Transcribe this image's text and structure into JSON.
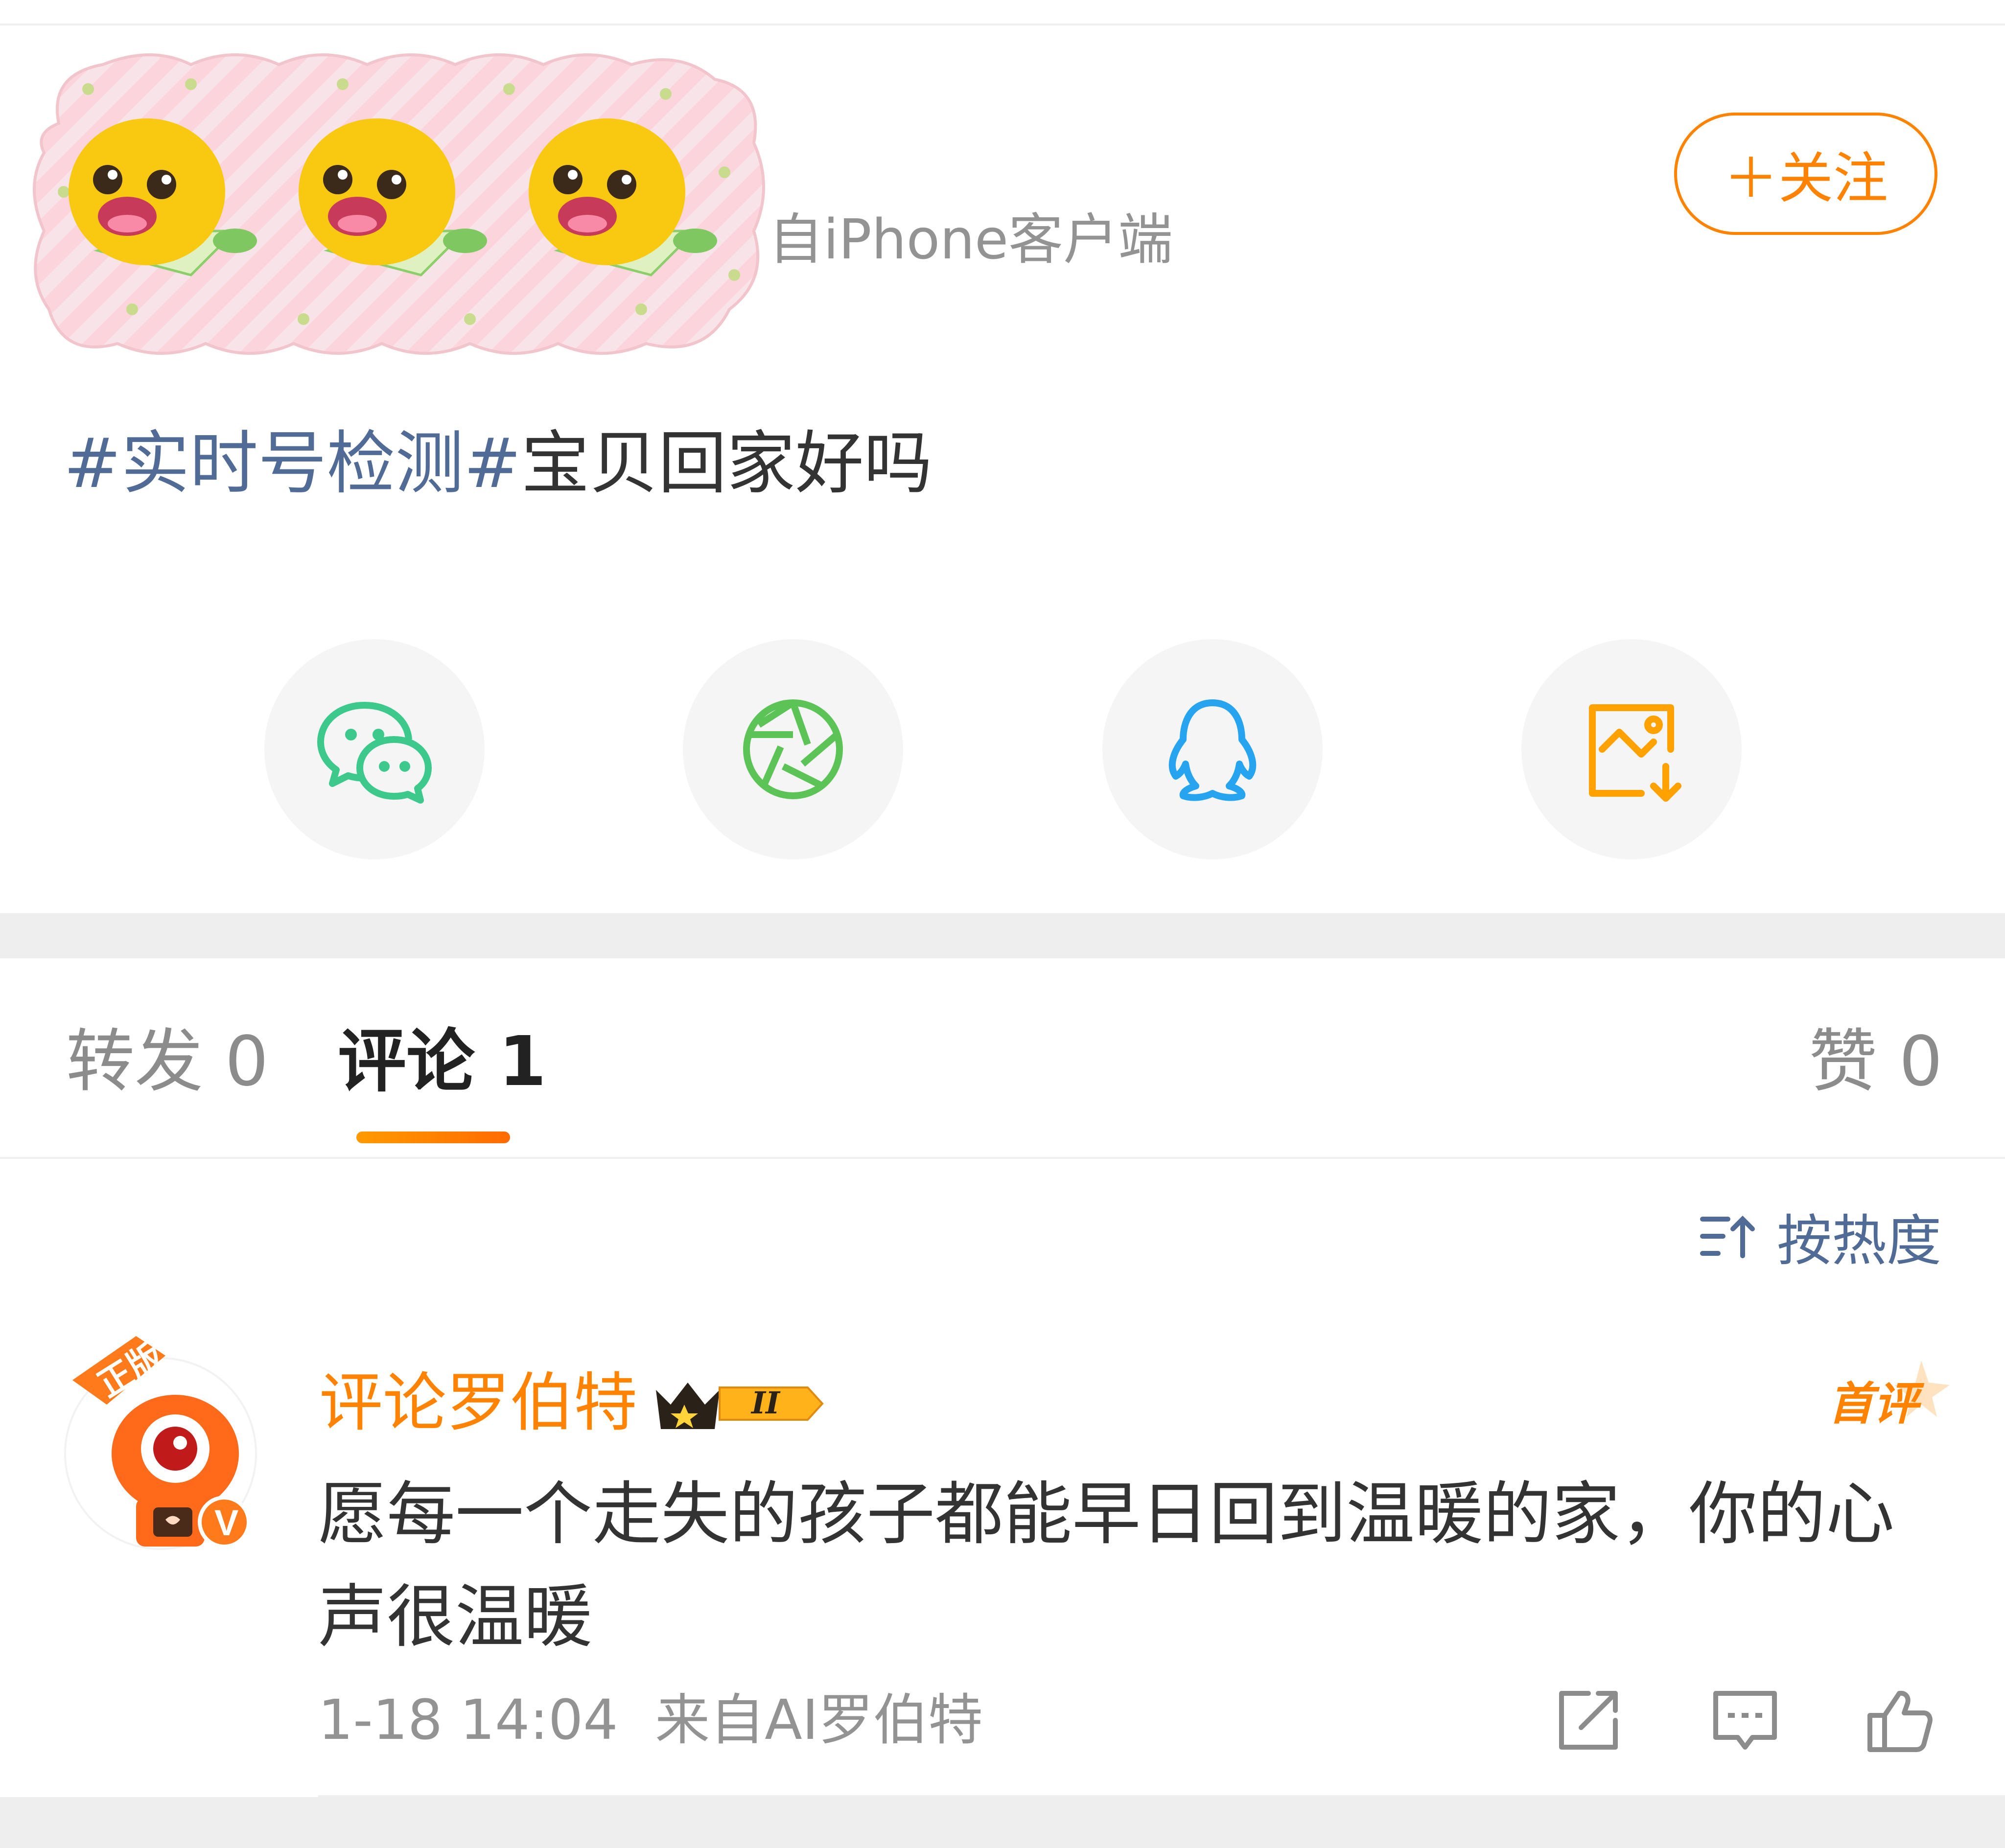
{
  "header": {
    "source_label": "自iPhone客户端",
    "follow_label": "＋关注"
  },
  "post": {
    "hashtag": "#实时号检测#",
    "text": "宝贝回家好吗"
  },
  "share": {
    "items": [
      "wechat",
      "moments",
      "qq",
      "save-image"
    ]
  },
  "tabs": {
    "repost": "转发 0",
    "comment": "评论 1",
    "like": "赞 0"
  },
  "sort": {
    "label": "按热度"
  },
  "comment": {
    "author": "评论罗伯特",
    "badge": "首评",
    "text": "愿每一个走失的孩子都能早日回到温暖的家，你的心声很温暖",
    "time": "1-18 14:04",
    "source": "来自AI罗伯特",
    "crown_level": "II",
    "avatar_tag": "正版"
  },
  "colors": {
    "accent": "#ff8200",
    "link": "#506b95",
    "muted": "#939393",
    "wechat": "#3dc98c",
    "moments": "#5cc456",
    "qq": "#27a4f0",
    "save": "#ffa200"
  }
}
